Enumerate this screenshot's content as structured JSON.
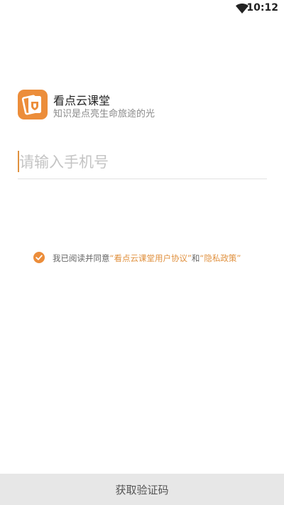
{
  "status_bar": {
    "time": "10:12",
    "wifi_icon": "wifi-icon"
  },
  "app": {
    "name": "看点云课堂",
    "slogan": "知识是点亮生命旅途的光",
    "logo_icon": "app-logo-icon",
    "brand_color": "#ec8d3a"
  },
  "login": {
    "phone_placeholder": "请输入手机号",
    "phone_value": ""
  },
  "agreement": {
    "checked": true,
    "prefix": "我已阅读并同意",
    "user_agreement": "“看点云课堂用户协议”",
    "conjunction": "和",
    "privacy_policy": "“隐私政策”",
    "link_color": "#e0913f"
  },
  "footer": {
    "get_code_label": "获取验证码"
  }
}
